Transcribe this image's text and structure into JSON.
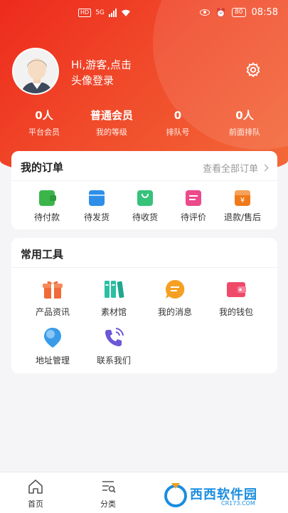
{
  "status_bar": {
    "badge": "HD",
    "network": "5G",
    "battery": "80",
    "time": "08:58"
  },
  "profile": {
    "login_prompt_line1": "Hi,游客,点击",
    "login_prompt_line2": "头像登录"
  },
  "stats": [
    {
      "value": "0人",
      "label": "平台会员"
    },
    {
      "value": "普通会员",
      "label": "我的等级"
    },
    {
      "value": "0",
      "label": "排队号"
    },
    {
      "value": "0人",
      "label": "前面排队"
    }
  ],
  "orders": {
    "title": "我的订单",
    "view_all": "查看全部订单",
    "items": [
      {
        "label": "待付款",
        "icon": "wallet-icon",
        "color": "#3bb54a"
      },
      {
        "label": "待发货",
        "icon": "box-icon",
        "color": "#2f8fe8"
      },
      {
        "label": "待收货",
        "icon": "bag-icon",
        "color": "#36c27a"
      },
      {
        "label": "待评价",
        "icon": "comment-icon",
        "color": "#ec4a8a"
      },
      {
        "label": "退款/售后",
        "icon": "refund-icon",
        "color": "#f07a1a"
      }
    ]
  },
  "tools": {
    "title": "常用工具",
    "items": [
      {
        "label": "产品资讯",
        "icon": "gift-icon",
        "color": "#f06a3a"
      },
      {
        "label": "素材馆",
        "icon": "books-icon",
        "color": "#2bbfa3"
      },
      {
        "label": "我的消息",
        "icon": "message-icon",
        "color": "#f5a023"
      },
      {
        "label": "我的钱包",
        "icon": "wallet-icon",
        "color": "#ef4a6a"
      },
      {
        "label": "地址管理",
        "icon": "location-icon",
        "color": "#3a9be8"
      },
      {
        "label": "联系我们",
        "icon": "phone-icon",
        "color": "#6a58d8"
      }
    ]
  },
  "bottom_nav": [
    {
      "label": "首页",
      "icon": "home-icon"
    },
    {
      "label": "分类",
      "icon": "category-icon"
    }
  ],
  "watermark": {
    "text": "西西软件园",
    "sub": "CR173.COM"
  },
  "colors": {
    "brand_red": "#ee2a1d",
    "accent_orange": "#f36a3a"
  }
}
